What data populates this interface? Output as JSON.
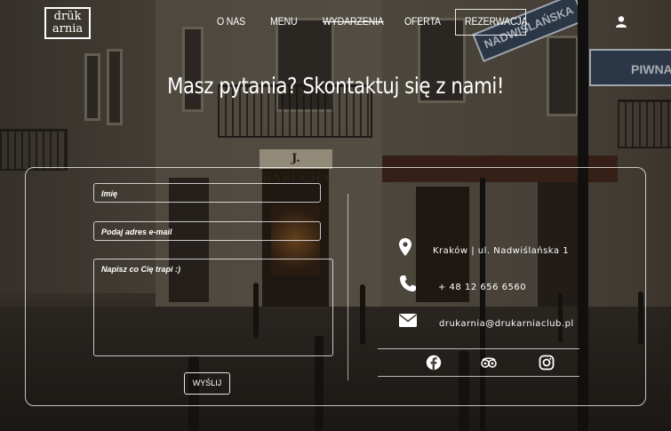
{
  "brand": {
    "logo_line1": "drük",
    "logo_line2": "arnia"
  },
  "nav": {
    "items": [
      {
        "label": "O NAS"
      },
      {
        "label": "MENU"
      },
      {
        "label": "WYDARZENIA"
      },
      {
        "label": "OFERTA"
      },
      {
        "label": "REZERWACJA"
      }
    ],
    "user_icon": "user-icon"
  },
  "page": {
    "heading": "Masz pytania? Skontaktuj się z nami!"
  },
  "photo": {
    "shop_sign": "J. BARUCHA",
    "street_sign_1": "NADWIŚLAŃSKA",
    "street_sign_2": "PIWNA"
  },
  "form": {
    "name_placeholder": "Imię",
    "email_placeholder": "Podaj adres e-mail",
    "message_placeholder": "Napisz co Cię trapi :)",
    "submit_label": "WYŚLIJ"
  },
  "contact": {
    "address": "Kraków | ul. Nadwiślańska 1",
    "phone": "+ 48 12 656 6560",
    "email": "drukarnia@drukarniaclub.pl",
    "icons": [
      "map-marker-icon",
      "phone-icon",
      "envelope-icon"
    ]
  },
  "social": [
    "facebook-icon",
    "tripadvisor-icon",
    "instagram-icon"
  ]
}
